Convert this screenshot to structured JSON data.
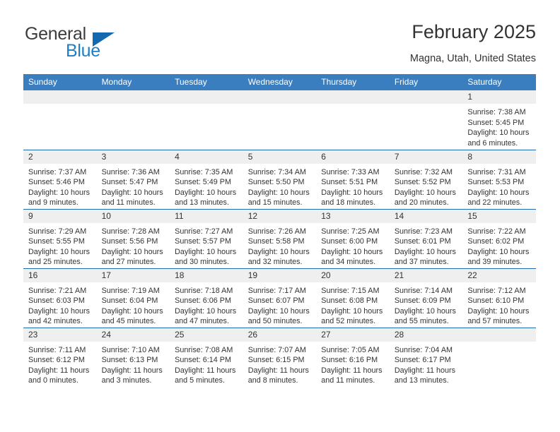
{
  "brand": {
    "name_top": "General",
    "name_bottom": "Blue",
    "triangle_color": "#1468b0",
    "blue_color": "#1f7ec4",
    "gray_color": "#3c3c3c"
  },
  "header": {
    "title": "February 2025",
    "subtitle": "Magna, Utah, United States"
  },
  "colors": {
    "header_blue": "#3a7ebf",
    "row_divider": "#1f6cb0",
    "daynum_band": "#efefef",
    "text": "#333333"
  },
  "weekday_headers": [
    "Sunday",
    "Monday",
    "Tuesday",
    "Wednesday",
    "Thursday",
    "Friday",
    "Saturday"
  ],
  "labels": {
    "sunrise_prefix": "Sunrise:",
    "sunset_prefix": "Sunset:",
    "daylight_prefix": "Daylight:"
  },
  "weeks": [
    [
      {
        "day": "",
        "empty": true
      },
      {
        "day": "",
        "empty": true
      },
      {
        "day": "",
        "empty": true
      },
      {
        "day": "",
        "empty": true
      },
      {
        "day": "",
        "empty": true
      },
      {
        "day": "",
        "empty": true
      },
      {
        "day": "1",
        "sunrise": "Sunrise: 7:38 AM",
        "sunset": "Sunset: 5:45 PM",
        "daylight": "Daylight: 10 hours and 6 minutes."
      }
    ],
    [
      {
        "day": "2",
        "sunrise": "Sunrise: 7:37 AM",
        "sunset": "Sunset: 5:46 PM",
        "daylight": "Daylight: 10 hours and 9 minutes."
      },
      {
        "day": "3",
        "sunrise": "Sunrise: 7:36 AM",
        "sunset": "Sunset: 5:47 PM",
        "daylight": "Daylight: 10 hours and 11 minutes."
      },
      {
        "day": "4",
        "sunrise": "Sunrise: 7:35 AM",
        "sunset": "Sunset: 5:49 PM",
        "daylight": "Daylight: 10 hours and 13 minutes."
      },
      {
        "day": "5",
        "sunrise": "Sunrise: 7:34 AM",
        "sunset": "Sunset: 5:50 PM",
        "daylight": "Daylight: 10 hours and 15 minutes."
      },
      {
        "day": "6",
        "sunrise": "Sunrise: 7:33 AM",
        "sunset": "Sunset: 5:51 PM",
        "daylight": "Daylight: 10 hours and 18 minutes."
      },
      {
        "day": "7",
        "sunrise": "Sunrise: 7:32 AM",
        "sunset": "Sunset: 5:52 PM",
        "daylight": "Daylight: 10 hours and 20 minutes."
      },
      {
        "day": "8",
        "sunrise": "Sunrise: 7:31 AM",
        "sunset": "Sunset: 5:53 PM",
        "daylight": "Daylight: 10 hours and 22 minutes."
      }
    ],
    [
      {
        "day": "9",
        "sunrise": "Sunrise: 7:29 AM",
        "sunset": "Sunset: 5:55 PM",
        "daylight": "Daylight: 10 hours and 25 minutes."
      },
      {
        "day": "10",
        "sunrise": "Sunrise: 7:28 AM",
        "sunset": "Sunset: 5:56 PM",
        "daylight": "Daylight: 10 hours and 27 minutes."
      },
      {
        "day": "11",
        "sunrise": "Sunrise: 7:27 AM",
        "sunset": "Sunset: 5:57 PM",
        "daylight": "Daylight: 10 hours and 30 minutes."
      },
      {
        "day": "12",
        "sunrise": "Sunrise: 7:26 AM",
        "sunset": "Sunset: 5:58 PM",
        "daylight": "Daylight: 10 hours and 32 minutes."
      },
      {
        "day": "13",
        "sunrise": "Sunrise: 7:25 AM",
        "sunset": "Sunset: 6:00 PM",
        "daylight": "Daylight: 10 hours and 34 minutes."
      },
      {
        "day": "14",
        "sunrise": "Sunrise: 7:23 AM",
        "sunset": "Sunset: 6:01 PM",
        "daylight": "Daylight: 10 hours and 37 minutes."
      },
      {
        "day": "15",
        "sunrise": "Sunrise: 7:22 AM",
        "sunset": "Sunset: 6:02 PM",
        "daylight": "Daylight: 10 hours and 39 minutes."
      }
    ],
    [
      {
        "day": "16",
        "sunrise": "Sunrise: 7:21 AM",
        "sunset": "Sunset: 6:03 PM",
        "daylight": "Daylight: 10 hours and 42 minutes."
      },
      {
        "day": "17",
        "sunrise": "Sunrise: 7:19 AM",
        "sunset": "Sunset: 6:04 PM",
        "daylight": "Daylight: 10 hours and 45 minutes."
      },
      {
        "day": "18",
        "sunrise": "Sunrise: 7:18 AM",
        "sunset": "Sunset: 6:06 PM",
        "daylight": "Daylight: 10 hours and 47 minutes."
      },
      {
        "day": "19",
        "sunrise": "Sunrise: 7:17 AM",
        "sunset": "Sunset: 6:07 PM",
        "daylight": "Daylight: 10 hours and 50 minutes."
      },
      {
        "day": "20",
        "sunrise": "Sunrise: 7:15 AM",
        "sunset": "Sunset: 6:08 PM",
        "daylight": "Daylight: 10 hours and 52 minutes."
      },
      {
        "day": "21",
        "sunrise": "Sunrise: 7:14 AM",
        "sunset": "Sunset: 6:09 PM",
        "daylight": "Daylight: 10 hours and 55 minutes."
      },
      {
        "day": "22",
        "sunrise": "Sunrise: 7:12 AM",
        "sunset": "Sunset: 6:10 PM",
        "daylight": "Daylight: 10 hours and 57 minutes."
      }
    ],
    [
      {
        "day": "23",
        "sunrise": "Sunrise: 7:11 AM",
        "sunset": "Sunset: 6:12 PM",
        "daylight": "Daylight: 11 hours and 0 minutes."
      },
      {
        "day": "24",
        "sunrise": "Sunrise: 7:10 AM",
        "sunset": "Sunset: 6:13 PM",
        "daylight": "Daylight: 11 hours and 3 minutes."
      },
      {
        "day": "25",
        "sunrise": "Sunrise: 7:08 AM",
        "sunset": "Sunset: 6:14 PM",
        "daylight": "Daylight: 11 hours and 5 minutes."
      },
      {
        "day": "26",
        "sunrise": "Sunrise: 7:07 AM",
        "sunset": "Sunset: 6:15 PM",
        "daylight": "Daylight: 11 hours and 8 minutes."
      },
      {
        "day": "27",
        "sunrise": "Sunrise: 7:05 AM",
        "sunset": "Sunset: 6:16 PM",
        "daylight": "Daylight: 11 hours and 11 minutes."
      },
      {
        "day": "28",
        "sunrise": "Sunrise: 7:04 AM",
        "sunset": "Sunset: 6:17 PM",
        "daylight": "Daylight: 11 hours and 13 minutes."
      },
      {
        "day": "",
        "empty": true
      }
    ]
  ]
}
